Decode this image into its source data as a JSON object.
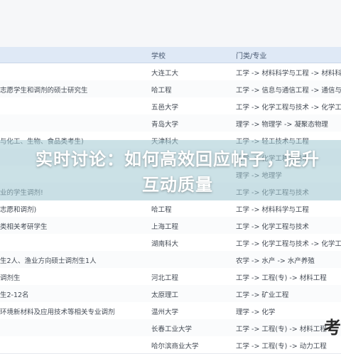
{
  "table": {
    "headers": {
      "description": "",
      "school": "学校",
      "major": "门类/专业"
    },
    "rows": [
      {
        "description": "",
        "school": "大连工大",
        "major": "工学 -> 材料科学与工程 -> 材料科学"
      },
      {
        "description": "志愿学生和调剂的硕士研究生",
        "school": "哈工程",
        "major": "工学 -> 信息与通信工程 -> 通信与信"
      },
      {
        "description": "",
        "school": "五邑大学",
        "major": "工学 -> 化学工程与技术 -> 化学工程"
      },
      {
        "description": "",
        "school": "青岛大学",
        "major": "理学 -> 物理学 -> 凝聚态物理"
      },
      {
        "description": "与化工、生物、食品类考生)",
        "school": "天津科大",
        "major": "工学 -> 轻工技术与工程"
      },
      {
        "description": "",
        "school": "",
        "major": "工学 -> 化学工程与技术"
      },
      {
        "description": "",
        "school": "",
        "major": "理学 -> 地理学"
      },
      {
        "description": "业的学生调剂!",
        "school": "",
        "major": "工学 -> 化学工程与技术"
      },
      {
        "description": "志愿和调剂)",
        "school": "哈工程",
        "major": "工学 -> 材料科学与工程"
      },
      {
        "description": "类相关考研学生",
        "school": "上海工程",
        "major": "工学 -> 化学工程与技术"
      },
      {
        "description": "",
        "school": "湖南科大",
        "major": "工学 -> 化学工程与技术 -> 化学工程"
      },
      {
        "description": "生2人、渔业方向硕士调剂生1人",
        "school": "",
        "major": "农学 -> 水产 -> 水产养殖"
      },
      {
        "description": "调剂生",
        "school": "河北工程",
        "major": "工学 -> 工程(专) -> 材料工程"
      },
      {
        "description": "生2-12名",
        "school": "太原理工",
        "major": "工学 -> 矿业工程"
      },
      {
        "description": "环境新材料及应用技术等相关专业调剂",
        "school": "温州大学",
        "major": "理学 -> 化学"
      },
      {
        "description": "",
        "school": "长春工业大学",
        "major": "工学 -> 工程(专) -> 材料工程"
      },
      {
        "description": "",
        "school": "哈尔滨商业大学",
        "major": "工学 -> 工程(专) -> 动力工程"
      }
    ]
  },
  "overlay": {
    "title": "实时讨论：如何高效回应帖子，提升互动质量",
    "color": "#a0c8d2"
  },
  "watermark": "考"
}
